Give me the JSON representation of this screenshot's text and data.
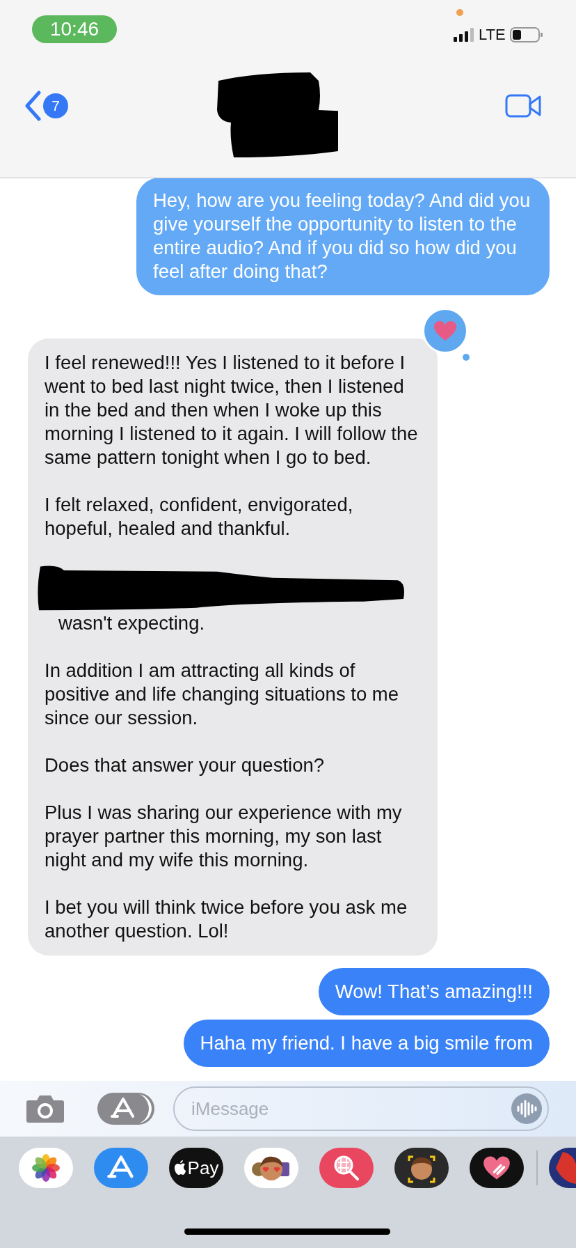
{
  "status_bar": {
    "time": "10:46",
    "network": "LTE",
    "privacy_dot": true
  },
  "nav": {
    "back_badge": "7",
    "name_redacted": true
  },
  "messages": [
    {
      "from_me": true,
      "hearted": false,
      "paragraphs": [
        {
          "kind": "text",
          "text": "Hey, how are you feeling today? And did you give yourself the opportunity to listen to the entire audio? And if you did so how did you feel after doing that?"
        }
      ]
    },
    {
      "from_me": false,
      "hearted": true,
      "paragraphs": [
        {
          "kind": "text",
          "text": "I feel renewed!!! Yes I listened to it before I went to bed last night twice, then I listened in the bed and then when I woke up this morning I listened to it again. I will follow the same pattern tonight when I go to bed."
        },
        {
          "kind": "text",
          "text": "I felt relaxed, confident, envigorated, hopeful, healed and thankful."
        },
        {
          "kind": "redacted",
          "text": "wasn't expecting."
        },
        {
          "kind": "text",
          "text": "In addition I am attracting all kinds of positive and life changing situations to me since our session."
        },
        {
          "kind": "text",
          "text": "Does that answer your question?"
        },
        {
          "kind": "text",
          "text": "Plus I was sharing our experience with my prayer partner this morning, my son last night and my wife this morning."
        },
        {
          "kind": "text",
          "text": "I bet you will think twice before you ask me another question. Lol!"
        }
      ]
    },
    {
      "from_me": true,
      "hearted": false,
      "paragraphs": [
        {
          "kind": "text",
          "text": "Wow! That’s amazing!!!"
        }
      ]
    },
    {
      "from_me": true,
      "hearted": false,
      "paragraphs": [
        {
          "kind": "text",
          "text": "Haha my friend. I have a big smile from"
        }
      ]
    }
  ],
  "composer": {
    "placeholder": "iMessage"
  },
  "app_drawer": [
    {
      "kind": "photos"
    },
    {
      "kind": "appstore"
    },
    {
      "kind": "applepay",
      "label": "Pay"
    },
    {
      "kind": "memoji"
    },
    {
      "kind": "search"
    },
    {
      "kind": "memoji-camera"
    },
    {
      "kind": "heart"
    },
    {
      "kind": "partial"
    }
  ]
}
